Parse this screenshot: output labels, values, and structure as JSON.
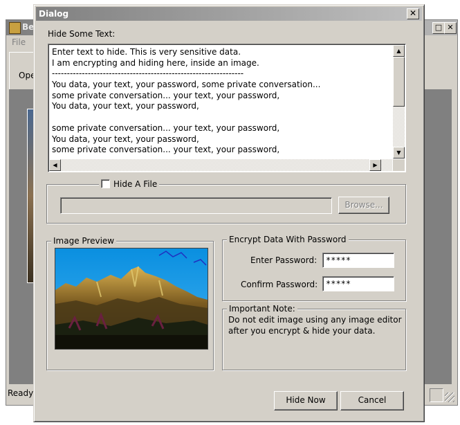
{
  "background_window": {
    "title": "Be",
    "menu_file": "File",
    "toolbar_open": "Ope",
    "status": "Ready"
  },
  "dialog": {
    "title": "Dialog",
    "close_glyph": "✕",
    "hide_text_label": "Hide Some Text:",
    "text_lines": [
      "Enter text to hide. This is very sensitive data.",
      "I am encrypting and hiding here, inside an image.",
      "----------------------------------------------------------------",
      "You data, your text, your password, some private conversation...",
      "some private conversation... your text, your password,",
      "You data, your text, your password,",
      "",
      "some private conversation... your text, your password,",
      "You data, your text, your password,",
      "some private conversation... your text, your password,"
    ],
    "hide_file": {
      "label": "Hide A File",
      "checked": false,
      "path_value": "",
      "browse_label": "Browse..."
    },
    "image_preview_label": "Image Preview",
    "encrypt": {
      "group_label": "Encrypt Data With Password",
      "enter_label": "Enter Password:",
      "enter_value": "*****",
      "confirm_label": "Confirm Password:",
      "confirm_value": "*****"
    },
    "note": {
      "group_label": "Important Note:",
      "text_line1": "Do not edit image using any image editor",
      "text_line2": "after you encrypt & hide your data."
    },
    "buttons": {
      "hide_now": "Hide Now",
      "cancel": "Cancel"
    }
  },
  "colors": {
    "face": "#d4d0c8",
    "shadow": "#808080",
    "title_inactive": "#808080"
  }
}
